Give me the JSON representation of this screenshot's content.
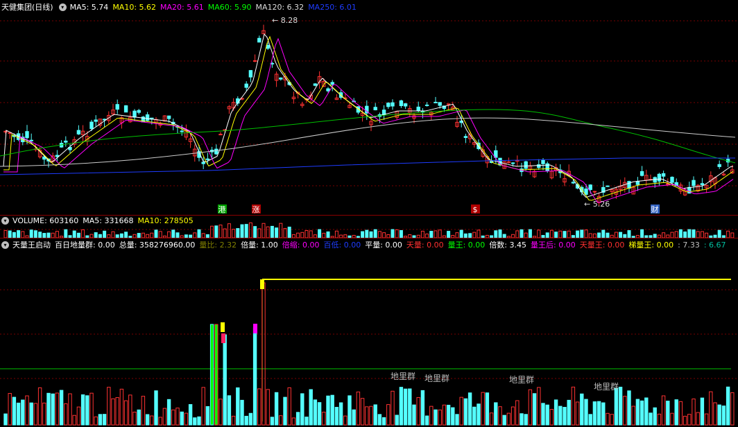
{
  "price_header": {
    "title": "天健集团(日线)",
    "items": [
      {
        "label": "MA5: 5.74",
        "color": "#ffffff"
      },
      {
        "label": "MA10: 5.62",
        "color": "#ffff00"
      },
      {
        "label": "MA20: 5.61",
        "color": "#ff00ff"
      },
      {
        "label": "MA60: 5.90",
        "color": "#00ff00"
      },
      {
        "label": "MA120: 6.32",
        "color": "#dddddd"
      },
      {
        "label": "MA250: 6.01",
        "color": "#1e3cff"
      }
    ]
  },
  "price_labels": {
    "high": "8.28",
    "low": "5.26"
  },
  "event_markers": [
    {
      "text": "港",
      "bg": "#00a000"
    },
    {
      "text": "涨",
      "bg": "#b00000"
    },
    {
      "text": "$",
      "bg": "#b00000"
    },
    {
      "text": "财",
      "bg": "#3060c0"
    }
  ],
  "volume_header": {
    "items": [
      {
        "label": "VOLUME: 603160",
        "color": "#ffffff"
      },
      {
        "label": "MA5: 331668",
        "color": "#ffffff"
      },
      {
        "label": "MA10: 278505",
        "color": "#ffff00"
      }
    ]
  },
  "indicator_header": {
    "items": [
      {
        "label": "天量王启动",
        "color": "#ffffff"
      },
      {
        "label": "百日地量群: 0.00",
        "color": "#ffffff"
      },
      {
        "label": "总量: 358276960.00",
        "color": "#ffffff"
      },
      {
        "label": "量比: 2.32",
        "color": "#808000"
      },
      {
        "label": "倍量: 1.00",
        "color": "#ffffff"
      },
      {
        "label": "倍缩: 0.00",
        "color": "#ff00ff"
      },
      {
        "label": "百低: 0.00",
        "color": "#1e3cff"
      },
      {
        "label": "平量: 0.00",
        "color": "#ffffff"
      },
      {
        "label": "天量: 0.00",
        "color": "#ff3030"
      },
      {
        "label": "量王: 0.00",
        "color": "#00ff00"
      },
      {
        "label": "倍数: 3.45",
        "color": "#ffffff"
      },
      {
        "label": "量王后: 0.00",
        "color": "#ff00ff"
      },
      {
        "label": "天量王: 0.00",
        "color": "#ff3030"
      },
      {
        "label": "梯量王: 0.00",
        "color": "#ffff00"
      },
      {
        "label": ": 7.33",
        "color": "#c0c0c0"
      },
      {
        "label": ": 6.67",
        "color": "#00c0a0"
      }
    ]
  },
  "indicator_labels": [
    "地里群",
    "地里群",
    "地里群",
    "地里群"
  ],
  "colors": {
    "up": "#ff3232",
    "down": "#54ffff",
    "bg": "#000000",
    "grid": "#7a0000"
  }
}
